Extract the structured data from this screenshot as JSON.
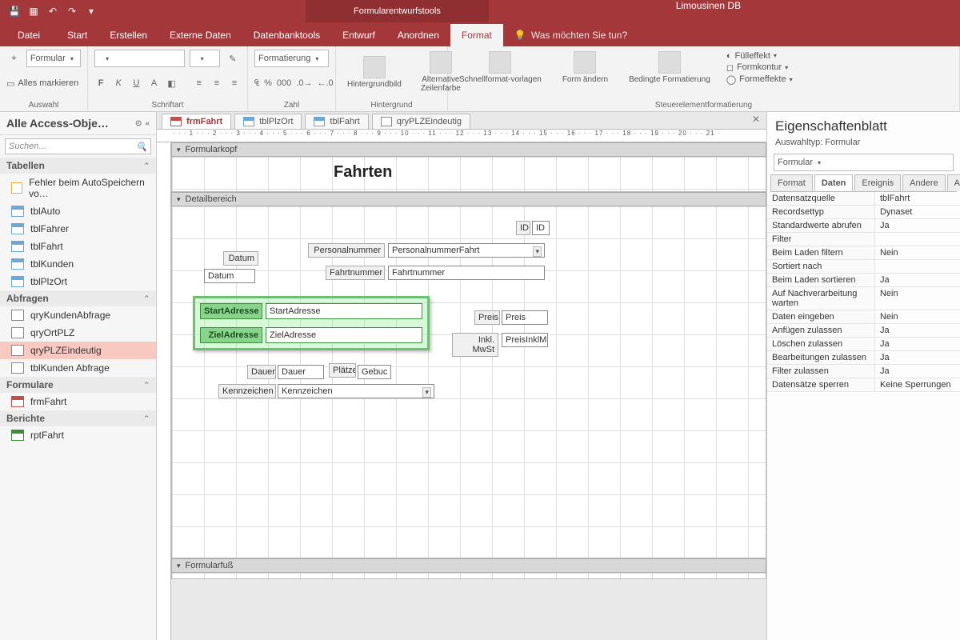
{
  "titlebar": {
    "tooltab": "Formularentwurfstools",
    "dbname": "Limousinen DB"
  },
  "ribbon_tabs": {
    "file": "Datei",
    "items": [
      "Start",
      "Erstellen",
      "Externe Daten",
      "Datenbanktools",
      "Entwurf",
      "Anordnen",
      "Format"
    ],
    "active": "Format",
    "tellme": "Was möchten Sie tun?"
  },
  "ribbon": {
    "selection_combo": "Formular",
    "select_all": "Alles markieren",
    "grp_selection": "Auswahl",
    "grp_font": "Schriftart",
    "grp_number": "Zahl",
    "format_combo": "Formatierung",
    "bg": {
      "label": "Hintergrundbild",
      "alt": "Alternative Zeilenfarbe",
      "caption": "Hintergrund"
    },
    "ctrlfmt": {
      "quick": "Schnellformat-vorlagen",
      "shape": "Form ändern",
      "cond": "Bedingte Formatierung",
      "fill": "Fülleffekt",
      "outline": "Formkontur",
      "effects": "Formeffekte",
      "caption": "Steuerelementformatierung"
    }
  },
  "nav": {
    "title": "Alle Access-Obje…",
    "search_ph": "Suchen…",
    "cats": {
      "tables": "Tabellen",
      "queries": "Abfragen",
      "forms": "Formulare",
      "reports": "Berichte"
    },
    "tables_err": "Fehler beim AutoSpeichern vo…",
    "tables": [
      "tblAuto",
      "tblFahrer",
      "tblFahrt",
      "tblKunden",
      "tblPlzOrt"
    ],
    "queries": [
      "qryKundenAbfrage",
      "qryOrtPLZ",
      "qryPLZEindeutig",
      "tblKunden Abfrage"
    ],
    "query_selected": "qryPLZEindeutig",
    "forms": [
      "frmFahrt"
    ],
    "reports": [
      "rptFahrt"
    ]
  },
  "doctabs": {
    "items": [
      {
        "label": "frmFahrt",
        "kind": "frm",
        "active": true
      },
      {
        "label": "tblPlzOrt",
        "kind": "tbl"
      },
      {
        "label": "tblFahrt",
        "kind": "tbl"
      },
      {
        "label": "qryPLZEindeutig",
        "kind": "qry"
      }
    ]
  },
  "ruler": "· · · 1 · · · 2 · · · 3 · · · 4 · · · 5 · · · 6 · · · 7 · · · 8 · · · 9 · · · 10 · · · 11 · · · 12 · · · 13 · · · 14 · · · 15 · · · 16 · · · 17 · · · 18 · · · 19 · · · 20 · · · 21 ·",
  "sections": {
    "header": "Formularkopf",
    "detail": "Detailbereich",
    "footer": "Formularfuß"
  },
  "form": {
    "title": "Fahrten",
    "labels": {
      "id": "ID",
      "id_bound": "ID",
      "personal": "Personalnummer",
      "personal_bound": "PersonalnummerFahrt",
      "fahrtn": "Fahrtnummer",
      "fahrtn_bound": "Fahrtnummer",
      "datum": "Datum",
      "datum_bound": "Datum",
      "start": "StartAdresse",
      "start_bound": "StartAdresse",
      "ziel": "ZielAdresse",
      "ziel_bound": "ZielAdresse",
      "preis": "Preis",
      "preis_bound": "Preis",
      "inkl": "Inkl. MwSt",
      "inkl_bound": "PreisInklM",
      "dauer": "Dauer",
      "dauer_bound": "Dauer",
      "plaetze": "Plätze",
      "gebucht": "Gebuc",
      "kenn": "Kennzeichen",
      "kenn_bound": "Kennzeichen"
    }
  },
  "props": {
    "title": "Eigenschaftenblatt",
    "subtype": "Auswahltyp:   Formular",
    "object": "Formular",
    "tabs": [
      "Format",
      "Daten",
      "Ereignis",
      "Andere",
      "Alle"
    ],
    "active": "Daten",
    "rows": [
      {
        "k": "Datensatzquelle",
        "v": "tblFahrt"
      },
      {
        "k": "Recordsettyp",
        "v": "Dynaset"
      },
      {
        "k": "Standardwerte abrufen",
        "v": "Ja"
      },
      {
        "k": "Filter",
        "v": ""
      },
      {
        "k": "Beim Laden filtern",
        "v": "Nein"
      },
      {
        "k": "Sortiert nach",
        "v": ""
      },
      {
        "k": "Beim Laden sortieren",
        "v": "Ja"
      },
      {
        "k": "Auf Nachverarbeitung warten",
        "v": "Nein"
      },
      {
        "k": "Daten eingeben",
        "v": "Nein"
      },
      {
        "k": "Anfügen zulassen",
        "v": "Ja"
      },
      {
        "k": "Löschen zulassen",
        "v": "Ja"
      },
      {
        "k": "Bearbeitungen zulassen",
        "v": "Ja"
      },
      {
        "k": "Filter zulassen",
        "v": "Ja"
      },
      {
        "k": "Datensätze sperren",
        "v": "Keine Sperrungen"
      }
    ]
  }
}
